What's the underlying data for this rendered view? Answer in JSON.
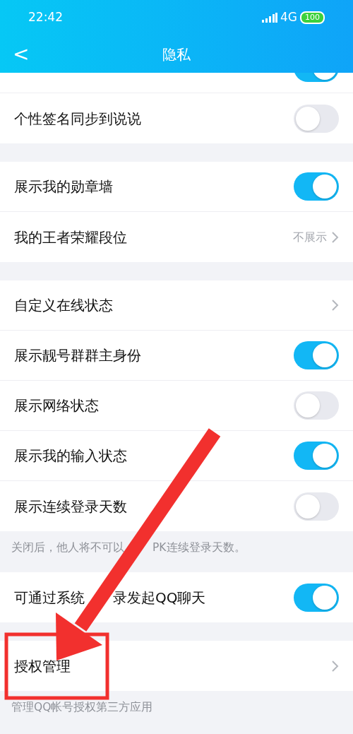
{
  "status_bar": {
    "time": "22:42",
    "network": "4G",
    "battery": "100"
  },
  "header": {
    "back": "<",
    "title": "隐私"
  },
  "groups": [
    {
      "rows": [
        {
          "kind": "partial_switch",
          "on": true
        },
        {
          "kind": "switch",
          "label": "个性签名同步到说说",
          "on": false
        }
      ]
    },
    {
      "rows": [
        {
          "kind": "switch",
          "label": "展示我的勋章墙",
          "on": true
        },
        {
          "kind": "link",
          "label": "我的王者荣耀段位",
          "value": "不展示"
        }
      ]
    },
    {
      "rows": [
        {
          "kind": "link",
          "label": "自定义在线状态"
        },
        {
          "kind": "switch",
          "label": "展示靓号群群主身份",
          "on": true
        },
        {
          "kind": "switch",
          "label": "展示网络状态",
          "on": false
        },
        {
          "kind": "switch",
          "label": "展示我的输入状态",
          "on": true
        },
        {
          "kind": "switch",
          "label": "展示连续登录天数",
          "on": false
        }
      ],
      "note_parts": [
        "关闭后，他人将不可以",
        "PK连续登录天数。"
      ]
    },
    {
      "rows": [
        {
          "kind": "switch",
          "label_parts": [
            "可通过系统",
            "录发起QQ聊天"
          ],
          "on": true
        }
      ]
    },
    {
      "rows": [
        {
          "kind": "link",
          "label": "授权管理"
        }
      ],
      "note_parts": [
        "管理QQ帐号授权第三方应用"
      ]
    }
  ]
}
